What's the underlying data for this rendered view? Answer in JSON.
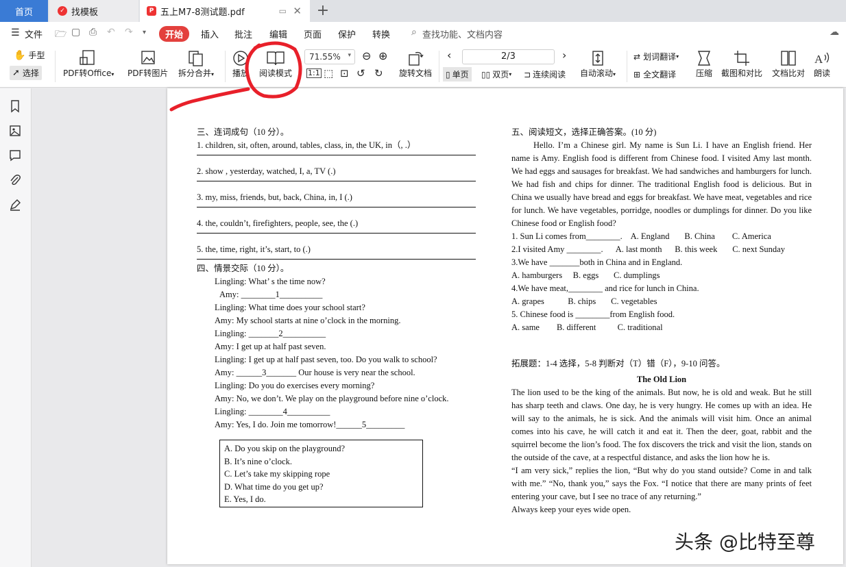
{
  "tabs": {
    "home": "首页",
    "templates": "找模板",
    "document": "五上M7-8测试题.pdf"
  },
  "menu": {
    "file": "文件",
    "start": "开始",
    "insert": "插入",
    "annotate": "批注",
    "edit": "编辑",
    "page": "页面",
    "protect": "保护",
    "convert": "转换",
    "search": "查找功能、文档内容"
  },
  "toolbar": {
    "hand": "手型",
    "select": "选择",
    "pdf_office": "PDF转Office",
    "pdf_image": "PDF转图片",
    "split_merge": "拆分合并",
    "play": "播放",
    "read_mode": "阅读模式",
    "zoom": "71.55%",
    "rotate": "旋转文档",
    "page_indicator": "2/3",
    "single": "单页",
    "double": "双页",
    "continuous": "连续阅读",
    "auto_scroll": "自动滚动",
    "word_translate": "划词翻译",
    "full_translate": "全文翻译",
    "compress": "压缩",
    "screenshot_compare": "截图和对比",
    "doc_compare": "文档比对",
    "read_aloud": "朗读"
  },
  "doc": {
    "left": {
      "s3_title": "三、连词成句（10 分）。",
      "s3_q1": "1. children, sit, often, around, tables, class, in, the UK, in（, .）",
      "s3_q2": "2. show , yesterday, watched, I, a, TV    (.)",
      "s3_q3": "3. my, miss, friends, but, back, China, in, I    (.)",
      "s3_q4": "4. the, couldn’t, firefighters, people, see, the (.)",
      "s3_q5": "5.  the, time, right, it’s, start, to (.)",
      "s4_title": "四、情景交际（10 分）。",
      "d1": "Lingling: What’ s the time now?",
      "d2": "Amy:    ________1__________",
      "d3": "Lingling: What time does your school start?",
      "d4": "Amy: My school starts at nine o’clock in the morning.",
      "d5": "Lingling: _______2__________",
      "d6": "Amy: I get up at half past seven.",
      "d7": "Lingling: I get up at half past seven, too. Do you walk to school?",
      "d8": "Amy: ______3_______ Our house is very near the school.",
      "d9": "Lingling: Do you do exercises every morning?",
      "d10": "Amy: No, we don’t. We play on the playground before nine o’clock.",
      "d11": "Lingling: ________4__________",
      "d12": "Amy: Yes, I do. Join me tomorrow!______5_________",
      "opts": [
        "A. Do you skip on the playground?",
        "B. It’s nine o’clock.",
        "C. Let’s take my skipping rope",
        "D. What time do you get up?",
        "E. Yes, I do."
      ]
    },
    "right": {
      "s5_title": "五、阅读短文，选择正确答案。(10 分)",
      "passage": "Hello. I’m a Chinese girl. My name is Sun Li. I have an English friend. Her name is Amy. English food is different from Chinese food. I visited Amy last month. We had eggs and sausages for breakfast. We had sandwiches and hamburgers for lunch. We had fish and chips for dinner. The traditional English food is delicious. But in China we usually have bread and eggs for breakfast. We have meat, vegetables and rice for lunch. We have vegetables, porridge, noodles or dumplings for dinner. Do you like Chinese food or English food?",
      "q1": "1. Sun Li comes from________.    A. England       B. China        C. America",
      "q2": "2.I visited Amy ________.      A. last month      B. this week       C. next Sunday",
      "q3": "3.We have _______both in China and in England.",
      "q3o": "A. hamburgers     B. eggs       C. dumplings",
      "q4": "4.We have meat,________ and rice for lunch in China.",
      "q4o": "A. grapes           B. chips       C. vegetables",
      "q5": "5. Chinese food is ________from English food.",
      "q5o": "A. same        B. different          C. traditional",
      "ext_title": "拓展题：1-4 选择，5-8 判断对（T）错（F），9-10 问答。",
      "story_title": "The Old Lion",
      "story1": "The lion used to be the king of the animals. But now, he is old and weak. But he still has sharp teeth and claws. One day, he is very hungry. He comes up with an idea. He will say to the animals, he is sick. And the animals will visit him. Once an animal comes into his cave, he will catch it and eat it. Then the deer, goat, rabbit and the squirrel become the lion’s food. The fox discovers the trick and visit the lion, stands on the outside of the cave, at a respectful distance, and asks the lion how he is.",
      "story2": "“I am very sick,” replies the lion, “But why do you stand outside? Come in and talk with me.” “No, thank you,” says the Fox. “I notice that there are many prints of feet entering your cave, but I see no trace of any returning.”",
      "story3": "Always keep your eyes wide open."
    }
  },
  "watermark": "头条 @比特至尊",
  "colors": {
    "accent": "#3a7bd5",
    "start_button": "#e3403d",
    "annotation": "#e8202a"
  }
}
